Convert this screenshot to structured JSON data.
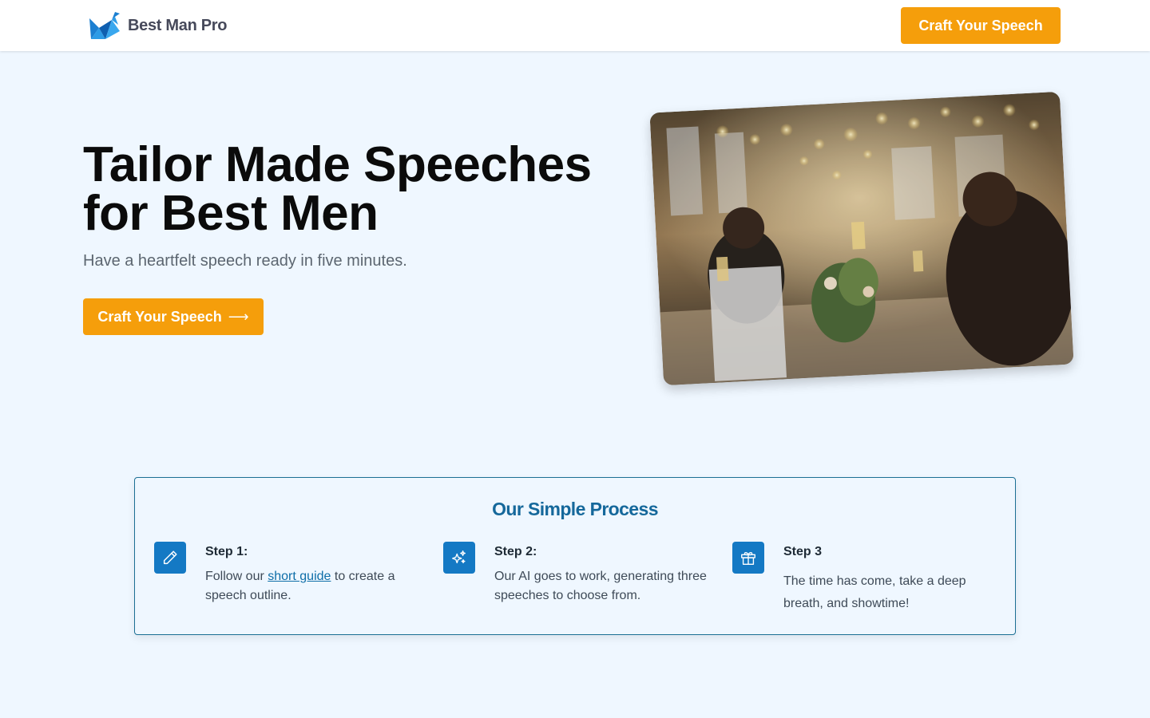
{
  "header": {
    "brand": "Best Man Pro",
    "cta_label": "Craft Your Speech"
  },
  "hero": {
    "title_line1": "Tailor Made Speeches",
    "title_line2": "for Best Men",
    "subtitle": "Have a heartfelt speech ready in five minutes.",
    "cta_label": "Craft Your Speech",
    "cta_arrow": "⟶"
  },
  "process": {
    "title": "Our Simple Process",
    "steps": [
      {
        "icon": "pencil-icon",
        "title": "Step 1:",
        "text_before": "Follow our ",
        "link_text": "short guide",
        "text_after": " to create a speech outline."
      },
      {
        "icon": "sparkles-icon",
        "title": "Step 2:",
        "text": "Our AI goes to work, generating three speeches to choose from."
      },
      {
        "icon": "gift-icon",
        "title": "Step 3",
        "text": "The time has come, take a deep breath, and showtime!"
      }
    ]
  },
  "colors": {
    "accent": "#f59e0b",
    "brand_blue": "#1479c4",
    "process_title": "#15689b",
    "background": "#eff7ff"
  }
}
